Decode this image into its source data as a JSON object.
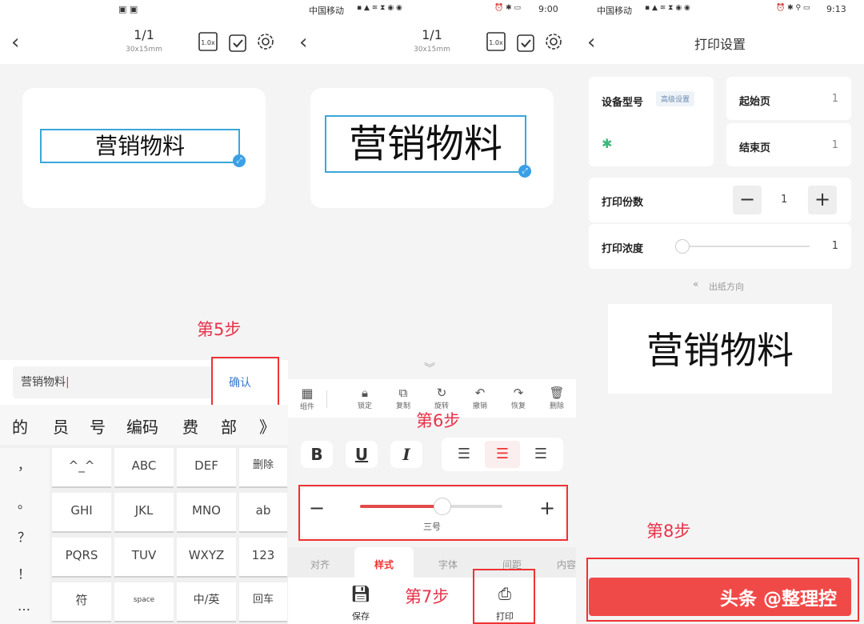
{
  "panel1": {
    "title": "1/1",
    "subtitle": "30x15mm",
    "zoom_label": "1.0x",
    "label_text": "营销物料",
    "step_label": "第5步",
    "input_value": "营销物料",
    "confirm_label": "确认",
    "candidates": [
      "的",
      "员",
      "号",
      "编码",
      "费",
      "部",
      "》"
    ],
    "side_chars": [
      "，",
      "。",
      "？",
      "！",
      "…"
    ],
    "keys": [
      [
        "^_^",
        "ABC",
        "DEF",
        "删除"
      ],
      [
        "GHI",
        "JKL",
        "MNO",
        "ab"
      ],
      [
        "PQRS",
        "TUV",
        "WXYZ",
        "123"
      ],
      [
        "符",
        "space",
        "中/英",
        "回车"
      ]
    ]
  },
  "panel2": {
    "status_left": "中国移动",
    "status_time": "9:00",
    "title": "1/1",
    "subtitle": "30x15mm",
    "zoom_label": "1.0x",
    "label_text": "营销物料",
    "tools": [
      "组件",
      "锁定",
      "复制",
      "旋转",
      "撤销",
      "恢复",
      "删除"
    ],
    "step6": "第6步",
    "format": {
      "bold": "B",
      "underline": "U",
      "italic": "I"
    },
    "slider_label": "三号",
    "slider_value": 0.58,
    "tabs": [
      "对齐",
      "样式",
      "字体",
      "间距",
      "内容"
    ],
    "active_tab": "样式",
    "save_label": "保存",
    "step7": "第7步",
    "print_label": "打印"
  },
  "panel3": {
    "status_left": "中国移动",
    "status_time": "9:13",
    "title": "打印设置",
    "device_label": "设备型号",
    "advanced_label": "高级设置",
    "start_label": "起始页",
    "start_value": "1",
    "end_label": "结束页",
    "end_value": "1",
    "copies_label": "打印份数",
    "copies_value": "1",
    "density_label": "打印浓度",
    "density_value": "1",
    "direction_label": "出纸方向",
    "preview_text": "营销物料",
    "step8": "第8步",
    "watermark": "头条 @整理控"
  },
  "colors": {
    "accent": "#3aa7d9",
    "step_red": "#e8334a",
    "print_button": "#f04a48"
  }
}
